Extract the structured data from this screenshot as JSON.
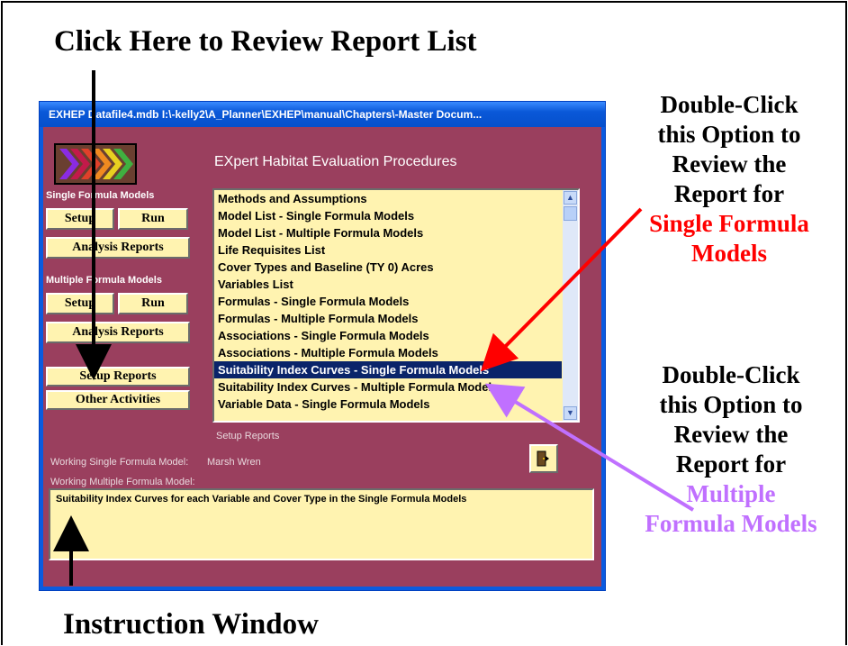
{
  "annotations": {
    "top_caption": "Click Here to Review Report List",
    "bottom_caption": "Instruction Window",
    "callout_single": {
      "line1": "Double-Click",
      "line2": "this Option to",
      "line3": "Review the",
      "line4": "Report for",
      "highlight1": "Single Formula",
      "highlight2": "Models",
      "highlight_color": "#ff0000"
    },
    "callout_multiple": {
      "line1": "Double-Click",
      "line2": "this Option to",
      "line3": "Review the",
      "line4": "Report for",
      "highlight1": "Multiple",
      "highlight2": "Formula Models",
      "highlight_color": "#c070ff"
    }
  },
  "window": {
    "title": "EXHEP   Datafile4.mdb   I:\\-kelly2\\A_Planner\\EXHEP\\manual\\Chapters\\-Master Docum...",
    "app_title": "EXpert Habitat Evaluation Procedures",
    "logo_icon": "arrow-chevrons-logo",
    "single_formula": {
      "label": "Single Formula Models",
      "setup": "Setup",
      "run": "Run",
      "analysis_reports": "Analysis Reports"
    },
    "multiple_formula": {
      "label": "Multiple Formula Models",
      "setup": "Setup",
      "run": "Run",
      "analysis_reports": "Analysis Reports"
    },
    "setup_reports": "Setup Reports",
    "other_activities": "Other Activities",
    "report_list": {
      "items": [
        "Methods and Assumptions",
        "Model List - Single Formula Models",
        "Model List - Multiple Formula Models",
        "Life Requisites List",
        "Cover Types and Baseline (TY 0) Acres",
        "Variables List",
        "Formulas - Single Formula Models",
        "Formulas - Multiple Formula Models",
        "Associations - Single Formula Models",
        "Associations - Multiple Formula Models",
        "Suitability Index Curves - Single Formula Models",
        "Suitability Index Curves - Multiple Formula Models",
        "Variable Data - Single Formula Models"
      ],
      "selected_index": 10,
      "caption": "Setup Reports"
    },
    "working_single_label": "Working Single Formula Model:",
    "working_single_value": "Marsh Wren",
    "working_multiple_label": "Working Multiple Formula Model:",
    "working_multiple_value": "",
    "exit_icon": "door-exit-icon",
    "instruction_text": "Suitability Index Curves for each Variable and Cover Type in the Single Formula Models",
    "colors": {
      "background": "#9a3f5e",
      "button": "#fff3b0",
      "selection": "#0a246a"
    }
  }
}
